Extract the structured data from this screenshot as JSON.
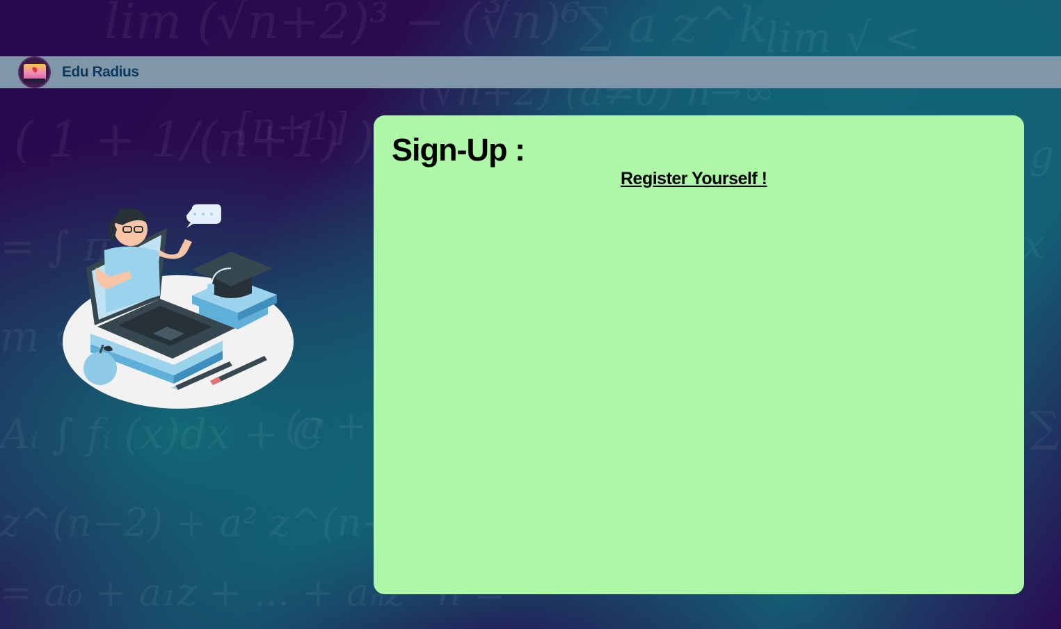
{
  "app": {
    "brand_name": "Edu Radius",
    "logo_icon": "edu-radius-logo",
    "logo_caption": "EDURADIUS"
  },
  "signup": {
    "title": "Sign-Up :",
    "subtitle": "Register Yourself !"
  },
  "illustration": {
    "icon": "online-teacher-illustration"
  },
  "colors": {
    "header_bg": "#7f97a9",
    "brand_text": "#0d3a5e",
    "card_bg": "#adf8a6",
    "bg_purple": "#2a0a4e",
    "bg_teal": "#136070"
  }
}
